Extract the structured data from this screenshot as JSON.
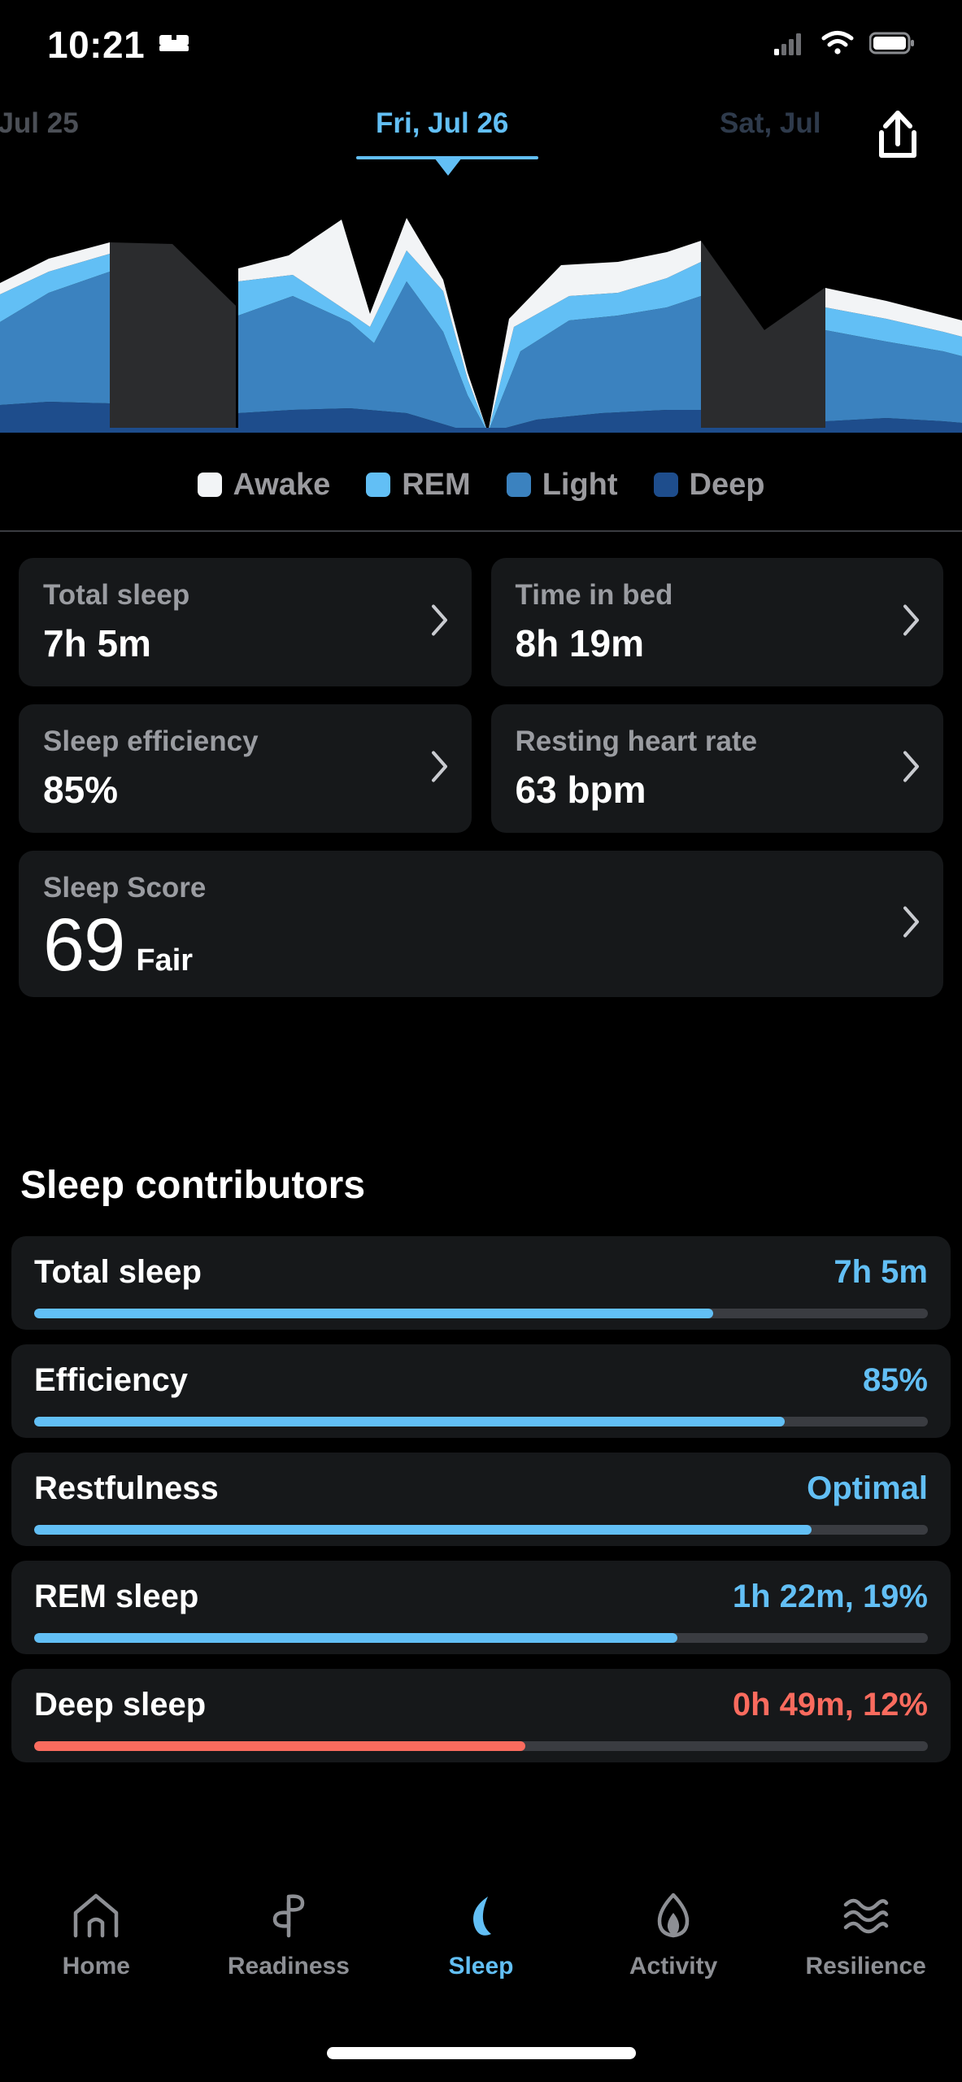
{
  "status_bar": {
    "time": "10:21",
    "bed_icon": "bed-icon",
    "signal_icon": "cellular-signal-icon",
    "wifi_icon": "wifi-icon",
    "battery_icon": "battery-icon"
  },
  "date_nav": {
    "previous": ", Jul 25",
    "current": "Fri, Jul 26",
    "next": "Sat, Jul",
    "share_icon": "share-icon"
  },
  "colors": {
    "accent_blue": "#62bff5",
    "awake": "#f2f4f6",
    "rem": "#62bff5",
    "light": "#3b82bf",
    "deep": "#1e4d8c",
    "gap": "#2b2c2e",
    "alert_red": "#fa6b5e",
    "track": "#3a3c41",
    "card_bg": "#16181a"
  },
  "chart_data": {
    "type": "area",
    "title": "Sleep stages hypnogram",
    "stages": [
      "Awake",
      "REM",
      "Light",
      "Deep"
    ],
    "legend": [
      {
        "label": "Awake",
        "color": "#f2f4f6"
      },
      {
        "label": "REM",
        "color": "#62bff5"
      },
      {
        "label": "Light",
        "color": "#3b82bf"
      },
      {
        "label": "Deep",
        "color": "#1e4d8c"
      }
    ],
    "legend_position": "bottom",
    "grid": false,
    "xlabel": "",
    "ylabel": "",
    "series": [
      {
        "name": "Awake",
        "values": [
          12,
          14,
          10,
          0,
          46,
          52,
          40,
          0,
          30,
          34,
          26,
          0,
          10,
          12
        ]
      },
      {
        "name": "REM",
        "values": [
          22,
          26,
          20,
          0,
          34,
          28,
          40,
          0,
          14,
          18,
          34,
          0,
          18,
          14
        ]
      },
      {
        "name": "Light",
        "values": [
          92,
          98,
          86,
          0,
          96,
          52,
          74,
          0,
          86,
          92,
          80,
          0,
          62,
          44
        ]
      },
      {
        "name": "Deep",
        "values": [
          14,
          14,
          12,
          0,
          18,
          18,
          14,
          0,
          12,
          14,
          12,
          0,
          8,
          8
        ]
      }
    ],
    "gaps": [
      3,
      7,
      11
    ]
  },
  "metric_cards": [
    {
      "label": "Total sleep",
      "value": "7h 5m",
      "chevron": "chevron-right-icon"
    },
    {
      "label": "Time in bed",
      "value": "8h 19m",
      "chevron": "chevron-right-icon"
    },
    {
      "label": "Sleep efficiency",
      "value": "85%",
      "chevron": "chevron-right-icon"
    },
    {
      "label": "Resting heart rate",
      "value": "63 bpm",
      "chevron": "chevron-right-icon"
    }
  ],
  "sleep_score": {
    "label": "Sleep Score",
    "value": "69",
    "qualifier": "Fair",
    "chevron": "chevron-right-icon"
  },
  "contributors": {
    "title": "Sleep contributors",
    "items": [
      {
        "name": "Total sleep",
        "value": "7h 5m",
        "percent": 76,
        "status": "good"
      },
      {
        "name": "Efficiency",
        "value": "85%",
        "percent": 84,
        "status": "good"
      },
      {
        "name": "Restfulness",
        "value": "Optimal",
        "percent": 87,
        "status": "good"
      },
      {
        "name": "REM sleep",
        "value": "1h 22m, 19%",
        "percent": 72,
        "status": "good"
      },
      {
        "name": "Deep sleep",
        "value": "0h 49m, 12%",
        "percent": 55,
        "status": "alert"
      }
    ]
  },
  "bottom_nav": {
    "items": [
      {
        "label": "Home",
        "icon": "home-icon",
        "active": false
      },
      {
        "label": "Readiness",
        "icon": "leaf-icon",
        "active": false
      },
      {
        "label": "Sleep",
        "icon": "moon-icon",
        "active": true
      },
      {
        "label": "Activity",
        "icon": "flame-icon",
        "active": false
      },
      {
        "label": "Resilience",
        "icon": "waves-icon",
        "active": false
      }
    ]
  }
}
